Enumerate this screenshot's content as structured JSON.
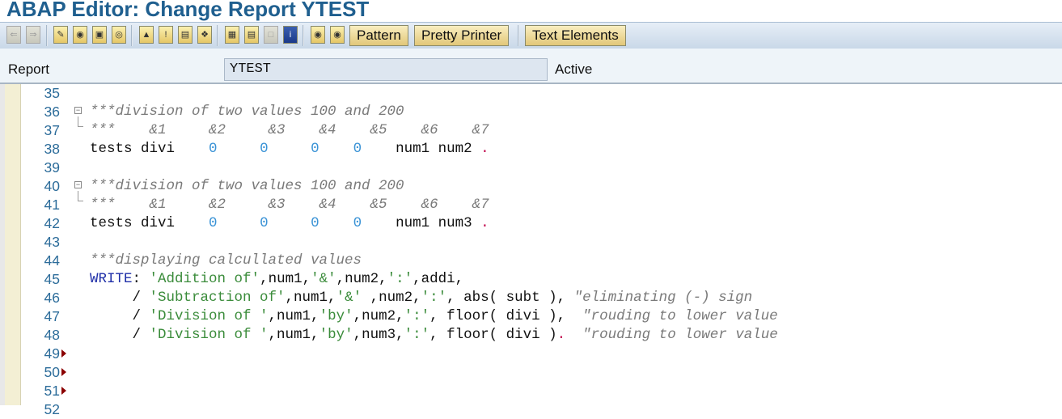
{
  "window": {
    "title": "ABAP Editor: Change Report YTEST"
  },
  "toolbar": {
    "icons": [
      "back-icon",
      "forward-icon",
      "display-change-icon",
      "other-object-icon",
      "check-icon",
      "activate-icon",
      "test-icon",
      "where-used-icon",
      "navigation-icon",
      "enhance-icon",
      "object-list-icon",
      "display-object-icon",
      "help-icon",
      "info-icon",
      "breakpoint-icon",
      "session-breakpoint-icon"
    ],
    "pattern_label": "Pattern",
    "pretty_printer_label": "Pretty Printer",
    "text_elements_label": "Text Elements"
  },
  "header": {
    "report_label": "Report",
    "report_value": "YTEST",
    "status": "Active"
  },
  "editor": {
    "lines": [
      {
        "num": "35",
        "marker": "",
        "tokens": []
      },
      {
        "num": "36",
        "marker": "fold",
        "tokens": [
          {
            "t": "comment",
            "v": "***division of two values 100 and 200"
          }
        ]
      },
      {
        "num": "37",
        "marker": "fold-end",
        "tokens": [
          {
            "t": "comment",
            "v": "***    &1     &2     &3    &4    &5    &6    &7"
          }
        ]
      },
      {
        "num": "38",
        "marker": "",
        "tokens": [
          {
            "t": "plain",
            "v": "tests divi    "
          },
          {
            "t": "number",
            "v": "0"
          },
          {
            "t": "plain",
            "v": "     "
          },
          {
            "t": "number",
            "v": "0"
          },
          {
            "t": "plain",
            "v": "     "
          },
          {
            "t": "number",
            "v": "0"
          },
          {
            "t": "plain",
            "v": "    "
          },
          {
            "t": "number",
            "v": "0"
          },
          {
            "t": "plain",
            "v": "    num1 num2 "
          },
          {
            "t": "dot",
            "v": "."
          }
        ]
      },
      {
        "num": "39",
        "marker": "",
        "tokens": []
      },
      {
        "num": "40",
        "marker": "fold",
        "tokens": [
          {
            "t": "comment",
            "v": "***division of two values 100 and 200"
          }
        ]
      },
      {
        "num": "41",
        "marker": "fold-end",
        "tokens": [
          {
            "t": "comment",
            "v": "***    &1     &2     &3    &4    &5    &6    &7"
          }
        ]
      },
      {
        "num": "42",
        "marker": "",
        "tokens": [
          {
            "t": "plain",
            "v": "tests divi    "
          },
          {
            "t": "number",
            "v": "0"
          },
          {
            "t": "plain",
            "v": "     "
          },
          {
            "t": "number",
            "v": "0"
          },
          {
            "t": "plain",
            "v": "     "
          },
          {
            "t": "number",
            "v": "0"
          },
          {
            "t": "plain",
            "v": "    "
          },
          {
            "t": "number",
            "v": "0"
          },
          {
            "t": "plain",
            "v": "    num1 num3 "
          },
          {
            "t": "dot",
            "v": "."
          }
        ]
      },
      {
        "num": "43",
        "marker": "",
        "tokens": []
      },
      {
        "num": "44",
        "marker": "",
        "tokens": [
          {
            "t": "comment",
            "v": "***displaying calcullated values"
          }
        ]
      },
      {
        "num": "45",
        "marker": "",
        "tokens": [
          {
            "t": "keyword",
            "v": "WRITE"
          },
          {
            "t": "plain",
            "v": ": "
          },
          {
            "t": "string",
            "v": "'Addition of'"
          },
          {
            "t": "plain",
            "v": ",num1,"
          },
          {
            "t": "string",
            "v": "'&'"
          },
          {
            "t": "plain",
            "v": ",num2,"
          },
          {
            "t": "string",
            "v": "':'"
          },
          {
            "t": "plain",
            "v": ",addi,"
          }
        ]
      },
      {
        "num": "46",
        "marker": "",
        "tokens": [
          {
            "t": "plain",
            "v": "     / "
          },
          {
            "t": "string",
            "v": "'Subtraction of'"
          },
          {
            "t": "plain",
            "v": ",num1,"
          },
          {
            "t": "string",
            "v": "'&'"
          },
          {
            "t": "plain",
            "v": " ,num2,"
          },
          {
            "t": "string",
            "v": "':'"
          },
          {
            "t": "plain",
            "v": ", abs( subt ), "
          },
          {
            "t": "comment",
            "v": "\"eliminating (-) sign"
          }
        ]
      },
      {
        "num": "47",
        "marker": "",
        "tokens": [
          {
            "t": "plain",
            "v": "     / "
          },
          {
            "t": "string",
            "v": "'Division of '"
          },
          {
            "t": "plain",
            "v": ",num1,"
          },
          {
            "t": "string",
            "v": "'by'"
          },
          {
            "t": "plain",
            "v": ",num2,"
          },
          {
            "t": "string",
            "v": "':'"
          },
          {
            "t": "plain",
            "v": ", floor( divi ),  "
          },
          {
            "t": "comment",
            "v": "\"rouding to lower value"
          }
        ]
      },
      {
        "num": "48",
        "marker": "",
        "tokens": [
          {
            "t": "plain",
            "v": "     / "
          },
          {
            "t": "string",
            "v": "'Division of '"
          },
          {
            "t": "plain",
            "v": ",num1,"
          },
          {
            "t": "string",
            "v": "'by'"
          },
          {
            "t": "plain",
            "v": ",num3,"
          },
          {
            "t": "string",
            "v": "':'"
          },
          {
            "t": "plain",
            "v": ", floor( divi )"
          },
          {
            "t": "dot",
            "v": "."
          },
          {
            "t": "plain",
            "v": "  "
          },
          {
            "t": "comment",
            "v": "\"rouding to lower value"
          }
        ]
      },
      {
        "num": "49",
        "marker": "arrow",
        "tokens": []
      },
      {
        "num": "50",
        "marker": "arrow",
        "tokens": []
      },
      {
        "num": "51",
        "marker": "arrow",
        "tokens": []
      },
      {
        "num": "52",
        "marker": "",
        "tokens": []
      }
    ]
  },
  "colors": {
    "title": "#1f5f8f",
    "comment": "#7a7a7a",
    "string": "#3b8c3b",
    "number": "#3a93d6",
    "keyword": "#1f2fa8",
    "line_number": "#2c6c9a"
  }
}
